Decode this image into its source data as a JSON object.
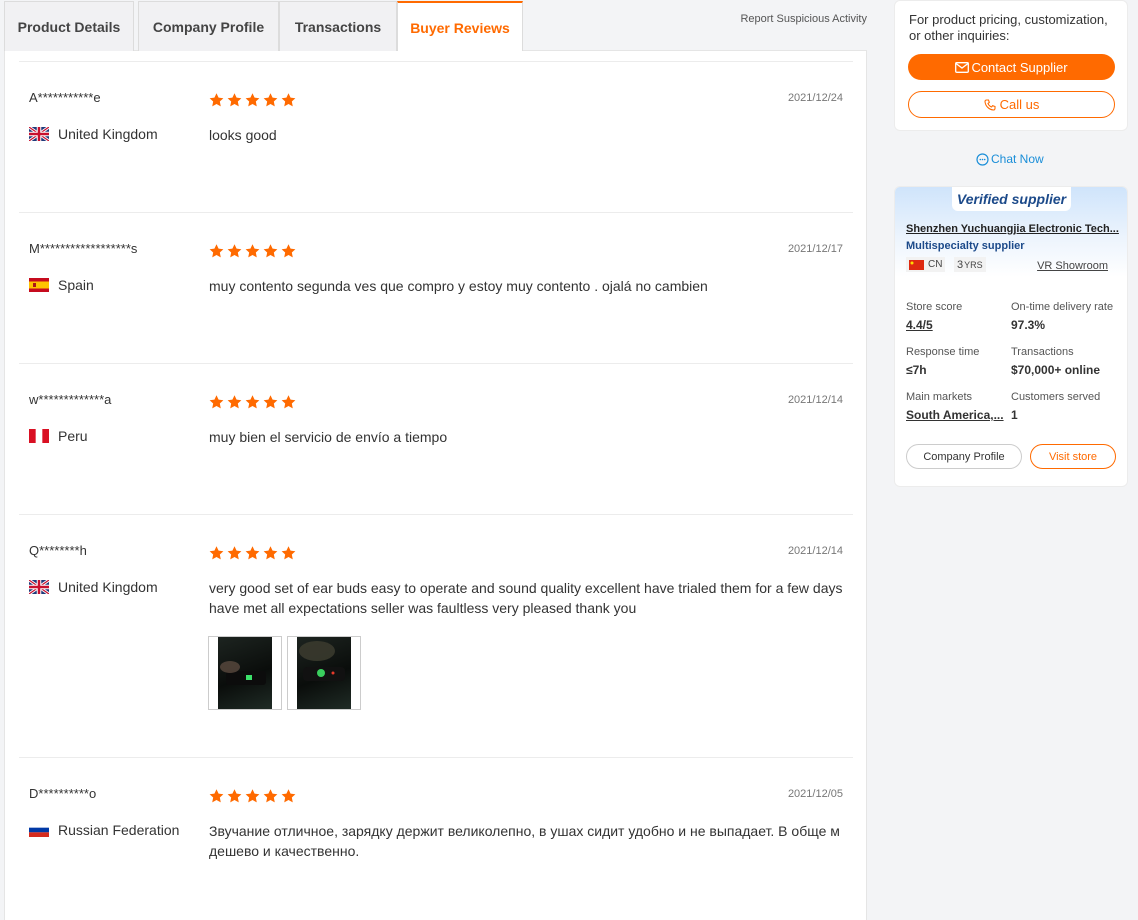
{
  "tabs": [
    {
      "label": "Product Details"
    },
    {
      "label": "Company Profile"
    },
    {
      "label": "Transactions"
    },
    {
      "label": "Buyer Reviews"
    }
  ],
  "report_link": "Report Suspicious Activity",
  "reviews": [
    {
      "buyer": "A***********e",
      "country": "United Kingdom",
      "flag": "uk-flag-icon",
      "rating": 5,
      "date": "2021/12/24",
      "text": "looks good"
    },
    {
      "buyer": "M******************s",
      "country": "Spain",
      "flag": "spain-flag-icon",
      "rating": 5,
      "date": "2021/12/17",
      "text": "muy contento segunda ves que compro y estoy muy contento . ojalá no cambien"
    },
    {
      "buyer": "w*************a",
      "country": "Peru",
      "flag": "peru-flag-icon",
      "rating": 5,
      "date": "2021/12/14",
      "text": "muy bien el servicio de envío a tiempo"
    },
    {
      "buyer": "Q********h",
      "country": "United Kingdom",
      "flag": "uk-flag-icon",
      "rating": 5,
      "date": "2021/12/14",
      "text": "very good set of ear buds easy to operate and sound quality excellent have trialed them for a few days have met all expectations seller was faultless very pleased thank you",
      "photos": 2
    },
    {
      "buyer": "D**********o",
      "country": "Russian Federation",
      "flag": "russia-flag-icon",
      "rating": 5,
      "date": "2021/12/05",
      "text": "Звучание отличное, зарядку держит великолепно, в ушах сидит удобно и не выпадает. В обще м дешево и качественно."
    }
  ],
  "inquiry": {
    "text": "For product pricing, customization, or other inquiries:",
    "contact_label": "Contact Supplier",
    "call_label": "Call us"
  },
  "chat_label": "Chat Now",
  "supplier": {
    "badge": "Verified supplier",
    "name": "Shenzhen Yuchuangjia Electronic Tech...",
    "type": "Multispecialty supplier",
    "country_code": "CN",
    "years": "3",
    "years_unit": "YRS",
    "vr_label": "VR Showroom",
    "stats": [
      {
        "label": "Store score",
        "value": "4.4/5"
      },
      {
        "label": "On-time delivery rate",
        "value": "97.3%"
      },
      {
        "label": "Response time",
        "value": "≤7h"
      },
      {
        "label": "Transactions",
        "value": "$70,000+ online"
      },
      {
        "label": "Main markets",
        "value": "South America,..."
      },
      {
        "label": "Customers served",
        "value": "1"
      }
    ],
    "company_profile_label": "Company Profile",
    "visit_store_label": "Visit store"
  },
  "colors": {
    "accent": "#ff6a00",
    "star": "#ff6a00",
    "link_blue": "#1a8ed8",
    "supplier_blue": "#1c4a8a"
  }
}
